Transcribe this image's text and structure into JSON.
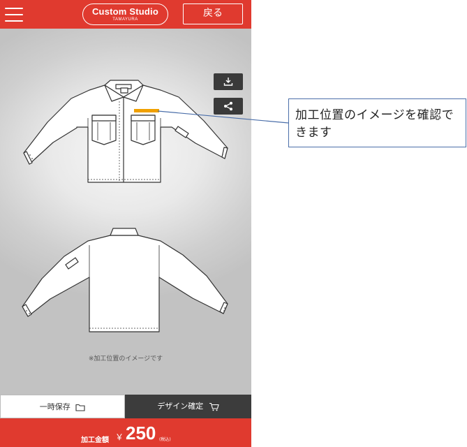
{
  "header": {
    "logo_main": "Custom Studio",
    "logo_sub": "TAMAYURA",
    "back_label": "戻る"
  },
  "tools": {
    "download_icon": "download-icon",
    "share_icon": "share-icon"
  },
  "preview": {
    "notice": "※加工位置のイメージです"
  },
  "actions": {
    "save_label": "一時保存",
    "confirm_label": "デザイン確定"
  },
  "price": {
    "label": "加工金額",
    "currency": "￥",
    "value": "250",
    "tax_note": "(税込)"
  },
  "annotation": {
    "text": "加工位置のイメージを確認できます"
  },
  "colors": {
    "brand_red": "#e03a2f",
    "dark": "#3c3c3c",
    "callout_border": "#4a6ea9",
    "print_mark": "#f0a000"
  }
}
